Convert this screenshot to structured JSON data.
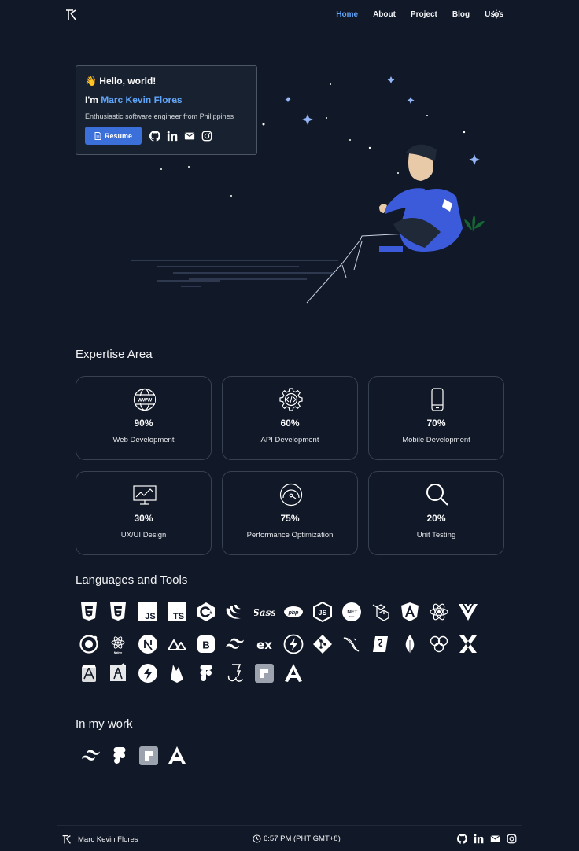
{
  "nav": {
    "links": [
      "Home",
      "About",
      "Project",
      "Blog",
      "Uses"
    ],
    "active_index": 0
  },
  "hero": {
    "greeting": "👋 Hello, world!",
    "intro_prefix": "I'm ",
    "name": "Marc Kevin Flores",
    "tagline": "Enthusiastic software engineer from Philippines",
    "resume_label": "Resume",
    "socials": [
      "github-icon",
      "linkedin-icon",
      "mail-icon",
      "instagram-icon"
    ]
  },
  "expertise": {
    "title": "Expertise Area",
    "items": [
      {
        "icon": "globe-icon",
        "percent": "90%",
        "label": "Web Development"
      },
      {
        "icon": "gear-code-icon",
        "percent": "60%",
        "label": "API Development"
      },
      {
        "icon": "mobile-icon",
        "percent": "70%",
        "label": "Mobile Development"
      },
      {
        "icon": "chart-monitor-icon",
        "percent": "30%",
        "label": "UX/UI Design"
      },
      {
        "icon": "speedometer-icon",
        "percent": "75%",
        "label": "Performance Optimization"
      },
      {
        "icon": "search-icon",
        "percent": "20%",
        "label": "Unit Testing"
      }
    ]
  },
  "languages": {
    "title": "Languages and Tools",
    "rows": [
      [
        "html5-icon",
        "css3-icon",
        "javascript-icon",
        "typescript-icon",
        "csharp-icon",
        "jquery-icon",
        "sass-icon",
        "php-icon",
        "nodejs-icon",
        "dotnet-icon",
        "laravel-icon",
        "angular-icon",
        "react-icon",
        "vue-icon"
      ],
      [
        "ionic-icon",
        "react-native-icon",
        "nextjs-icon",
        "nuxt-icon",
        "bootstrap-icon",
        "tailwind-icon",
        "express-icon",
        "fastify-icon",
        "git-icon",
        "mysql-icon",
        "sanity-icon",
        "mongodb-icon",
        "graphql-icon",
        "xstate-icon"
      ],
      [
        "android-studio-icon",
        "app-icon",
        "supabase-icon",
        "firebase-icon",
        "figma-icon",
        "jest-icon",
        "stackbit-icon",
        "angular-alt-icon"
      ]
    ],
    "glyph_text": {
      "javascript": "JS",
      "typescript": "TS",
      "php": "php",
      "dotnet": ".NET",
      "express": "ex",
      "bootstrap": "B"
    }
  },
  "work": {
    "title": "In my work",
    "items": [
      "tailwind-icon",
      "figma-icon",
      "stackbit-icon",
      "angular-icon"
    ]
  },
  "footer": {
    "name": "Marc Kevin Flores",
    "time": "6:57 PM (PHT GMT+8)"
  },
  "colors": {
    "background": "#111827",
    "accent": "#60a5fa",
    "button": "#3b6fd9"
  }
}
